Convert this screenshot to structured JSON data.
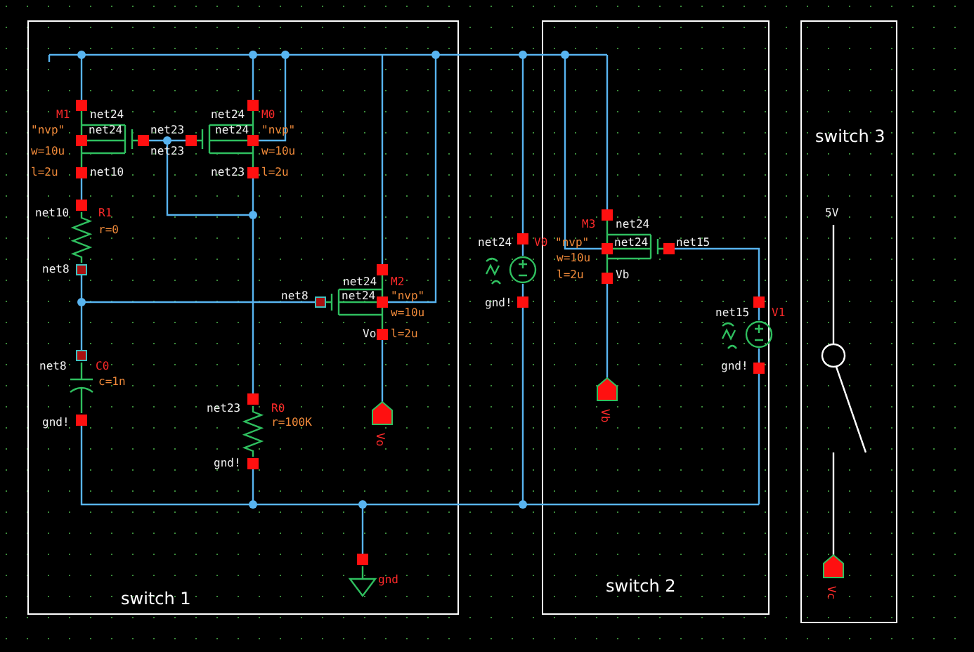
{
  "frames": [
    {
      "title": "switch 1"
    },
    {
      "title": "switch 2"
    },
    {
      "title": "switch 3"
    }
  ],
  "labels": [
    {
      "text": "M1",
      "kind": "instance"
    },
    {
      "text": "net24",
      "kind": "net"
    },
    {
      "text": "net24",
      "kind": "net"
    },
    {
      "text": "M0",
      "kind": "instance"
    },
    {
      "text": "\"nvp\"",
      "kind": "param"
    },
    {
      "text": "net24",
      "kind": "net"
    },
    {
      "text": "net23",
      "kind": "net"
    },
    {
      "text": "net24",
      "kind": "net"
    },
    {
      "text": "\"nvp\"",
      "kind": "param"
    },
    {
      "text": "w=10u",
      "kind": "param"
    },
    {
      "text": "net23",
      "kind": "net"
    },
    {
      "text": "w=10u",
      "kind": "param"
    },
    {
      "text": "l=2u",
      "kind": "param"
    },
    {
      "text": "net10",
      "kind": "net"
    },
    {
      "text": "net23",
      "kind": "net"
    },
    {
      "text": "l=2u",
      "kind": "param"
    },
    {
      "text": "net10",
      "kind": "net"
    },
    {
      "text": "R1",
      "kind": "instance"
    },
    {
      "text": "5V",
      "kind": "net"
    },
    {
      "text": "M3",
      "kind": "instance"
    },
    {
      "text": "net24",
      "kind": "net"
    },
    {
      "text": "r=0",
      "kind": "param"
    },
    {
      "text": "net24",
      "kind": "net"
    },
    {
      "text": "V0",
      "kind": "instance"
    },
    {
      "text": "\"nvp\"",
      "kind": "param"
    },
    {
      "text": "net24",
      "kind": "net"
    },
    {
      "text": "net15",
      "kind": "net"
    },
    {
      "text": "w=10u",
      "kind": "param"
    },
    {
      "text": "net8",
      "kind": "net"
    },
    {
      "text": "l=2u",
      "kind": "param"
    },
    {
      "text": "Vb",
      "kind": "net"
    },
    {
      "text": "net24",
      "kind": "net"
    },
    {
      "text": "M2",
      "kind": "instance"
    },
    {
      "text": "net8",
      "kind": "net"
    },
    {
      "text": "net24",
      "kind": "net"
    },
    {
      "text": "\"nvp\"",
      "kind": "param"
    },
    {
      "text": "gnd!",
      "kind": "net"
    },
    {
      "text": "w=10u",
      "kind": "param"
    },
    {
      "text": "net15",
      "kind": "net"
    },
    {
      "text": "V1",
      "kind": "instance"
    },
    {
      "text": "Vo",
      "kind": "net"
    },
    {
      "text": "l=2u",
      "kind": "param"
    },
    {
      "text": "net8",
      "kind": "net"
    },
    {
      "text": "C0",
      "kind": "instance"
    },
    {
      "text": "gnd!",
      "kind": "net"
    },
    {
      "text": "c=1n",
      "kind": "param"
    },
    {
      "text": "net23",
      "kind": "net"
    },
    {
      "text": "R0",
      "kind": "instance"
    },
    {
      "text": "gnd!",
      "kind": "net"
    },
    {
      "text": "r=100K",
      "kind": "param"
    },
    {
      "text": "gnd!",
      "kind": "net"
    },
    {
      "text": "gnd",
      "kind": "instance"
    }
  ],
  "pins": [
    {
      "name": "Vo"
    },
    {
      "name": "Vb"
    },
    {
      "name": "Vc"
    }
  ]
}
